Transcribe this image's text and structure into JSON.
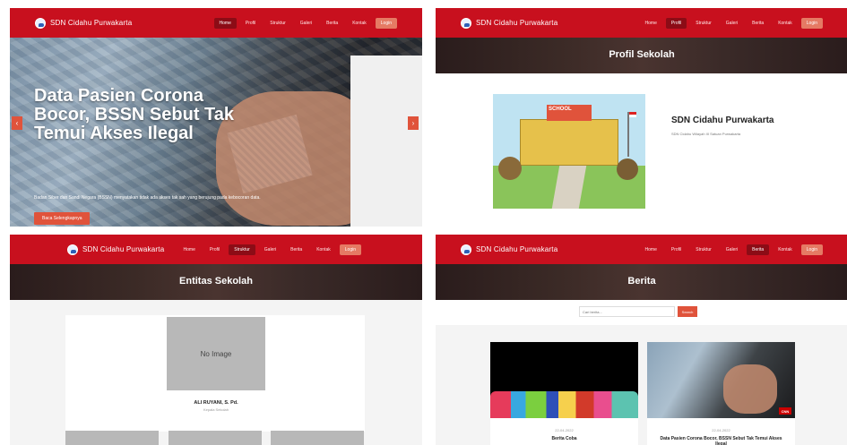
{
  "site": {
    "brand": "SDN Cidahu Purwakarta"
  },
  "nav": {
    "items": [
      "Home",
      "Profil",
      "Struktur",
      "Galeri",
      "Berita",
      "Kontak"
    ],
    "login": "Login"
  },
  "panel1": {
    "active": "Home",
    "hero": {
      "headline": "Data Pasien Corona Bocor, BSSN Sebut Tak Temui Akses Ilegal",
      "caption": "Badan Siber dan Sandi Negara (BSSN) menyatakan tidak ada akses tak sah yang berujung pada kebocoran data.",
      "button": "Baca Selengkapnya",
      "prev": "‹",
      "next": "›"
    }
  },
  "panel2": {
    "active": "Profil",
    "title": "Profil Sekolah",
    "school_sign": "SCHOOL",
    "name": "SDN Cidahu Purwakarta",
    "subtitle": "SDN Cidahu Wilayah III Satuan Purwakarta"
  },
  "panel3": {
    "active": "Struktur",
    "title": "Entitas Sekolah",
    "no_image": "No Image",
    "person_name": "ALI RUYANI, S. Pd.",
    "person_role": "Kepala Sekolah"
  },
  "panel4": {
    "active": "Berita",
    "title": "Berita",
    "search_placeholder": "Cari berita...",
    "search_button": "Search",
    "news": [
      {
        "date": "22-04-2022",
        "title": "Berita Coba"
      },
      {
        "date": "22-04-2022",
        "title": "Data Pasien Corona Bocor, BSSN Sebut Tak Temui Akses Ilegal",
        "badge": "CNN"
      }
    ]
  },
  "colors": {
    "primary": "#c8101e",
    "accent": "#e0533b",
    "active_nav": "#8c0c16"
  }
}
